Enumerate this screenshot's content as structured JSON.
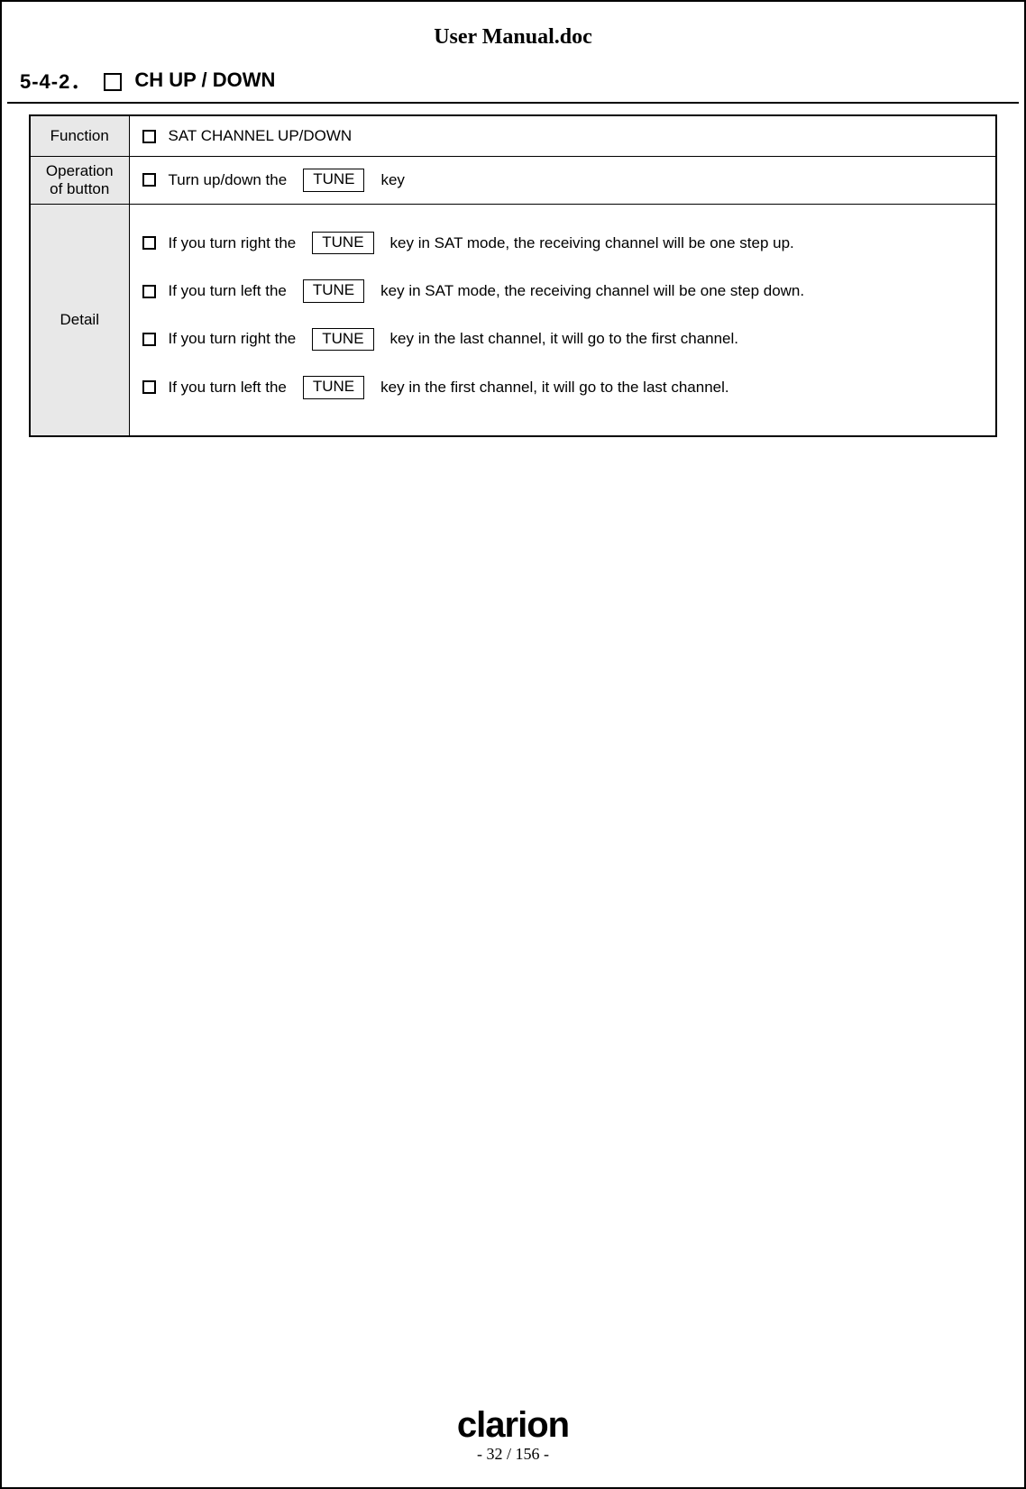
{
  "header": {
    "title": "User Manual.doc"
  },
  "section": {
    "number": "5-4-2．",
    "title": "CH UP / DOWN"
  },
  "keycap": "TUNE",
  "table": {
    "rows": {
      "function": {
        "label": "Function",
        "text": "SAT CHANNEL UP/DOWN"
      },
      "operation": {
        "label_line1": "Operation",
        "label_line2": "of button",
        "pre": "Turn up/down the",
        "post": "key"
      },
      "detail": {
        "label": "Detail",
        "items": [
          {
            "pre": "If you turn right the",
            "post": "key in SAT mode, the receiving channel will be one step up."
          },
          {
            "pre": "If you turn left the",
            "post": "key in SAT mode, the receiving channel will be one step down."
          },
          {
            "pre": "If you turn right the",
            "post": "key in the last channel, it will go to the first channel."
          },
          {
            "pre": "If you turn left the",
            "post": "key in the first channel, it will go to the last channel."
          }
        ]
      }
    }
  },
  "footer": {
    "brand": "clarion",
    "page": "- 32 / 156 -"
  }
}
